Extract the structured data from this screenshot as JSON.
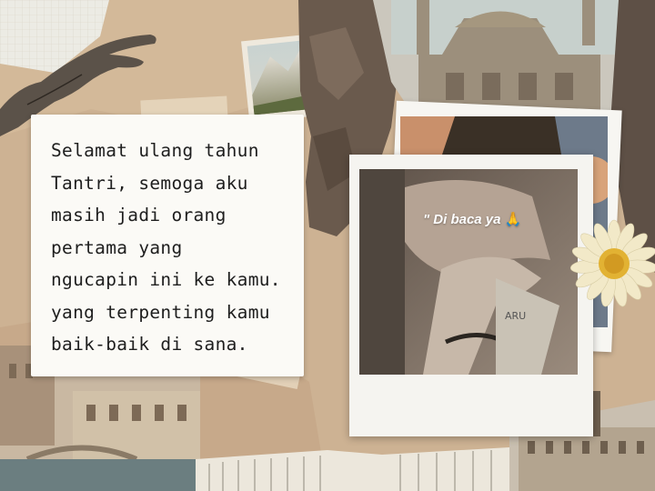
{
  "note": {
    "text": "Selamat ulang tahun\nTantri, semoga aku\nmasih jadi orang\npertama yang\nngucapin ini ke kamu.\nyang terpenting kamu\nbaik-baik di sana."
  },
  "photo": {
    "caption": "\" Di baca ya",
    "caption_emoji": "🙏"
  },
  "colors": {
    "paper": "#cdb293",
    "card": "#fbfaf6",
    "text": "#1e1e1e"
  }
}
